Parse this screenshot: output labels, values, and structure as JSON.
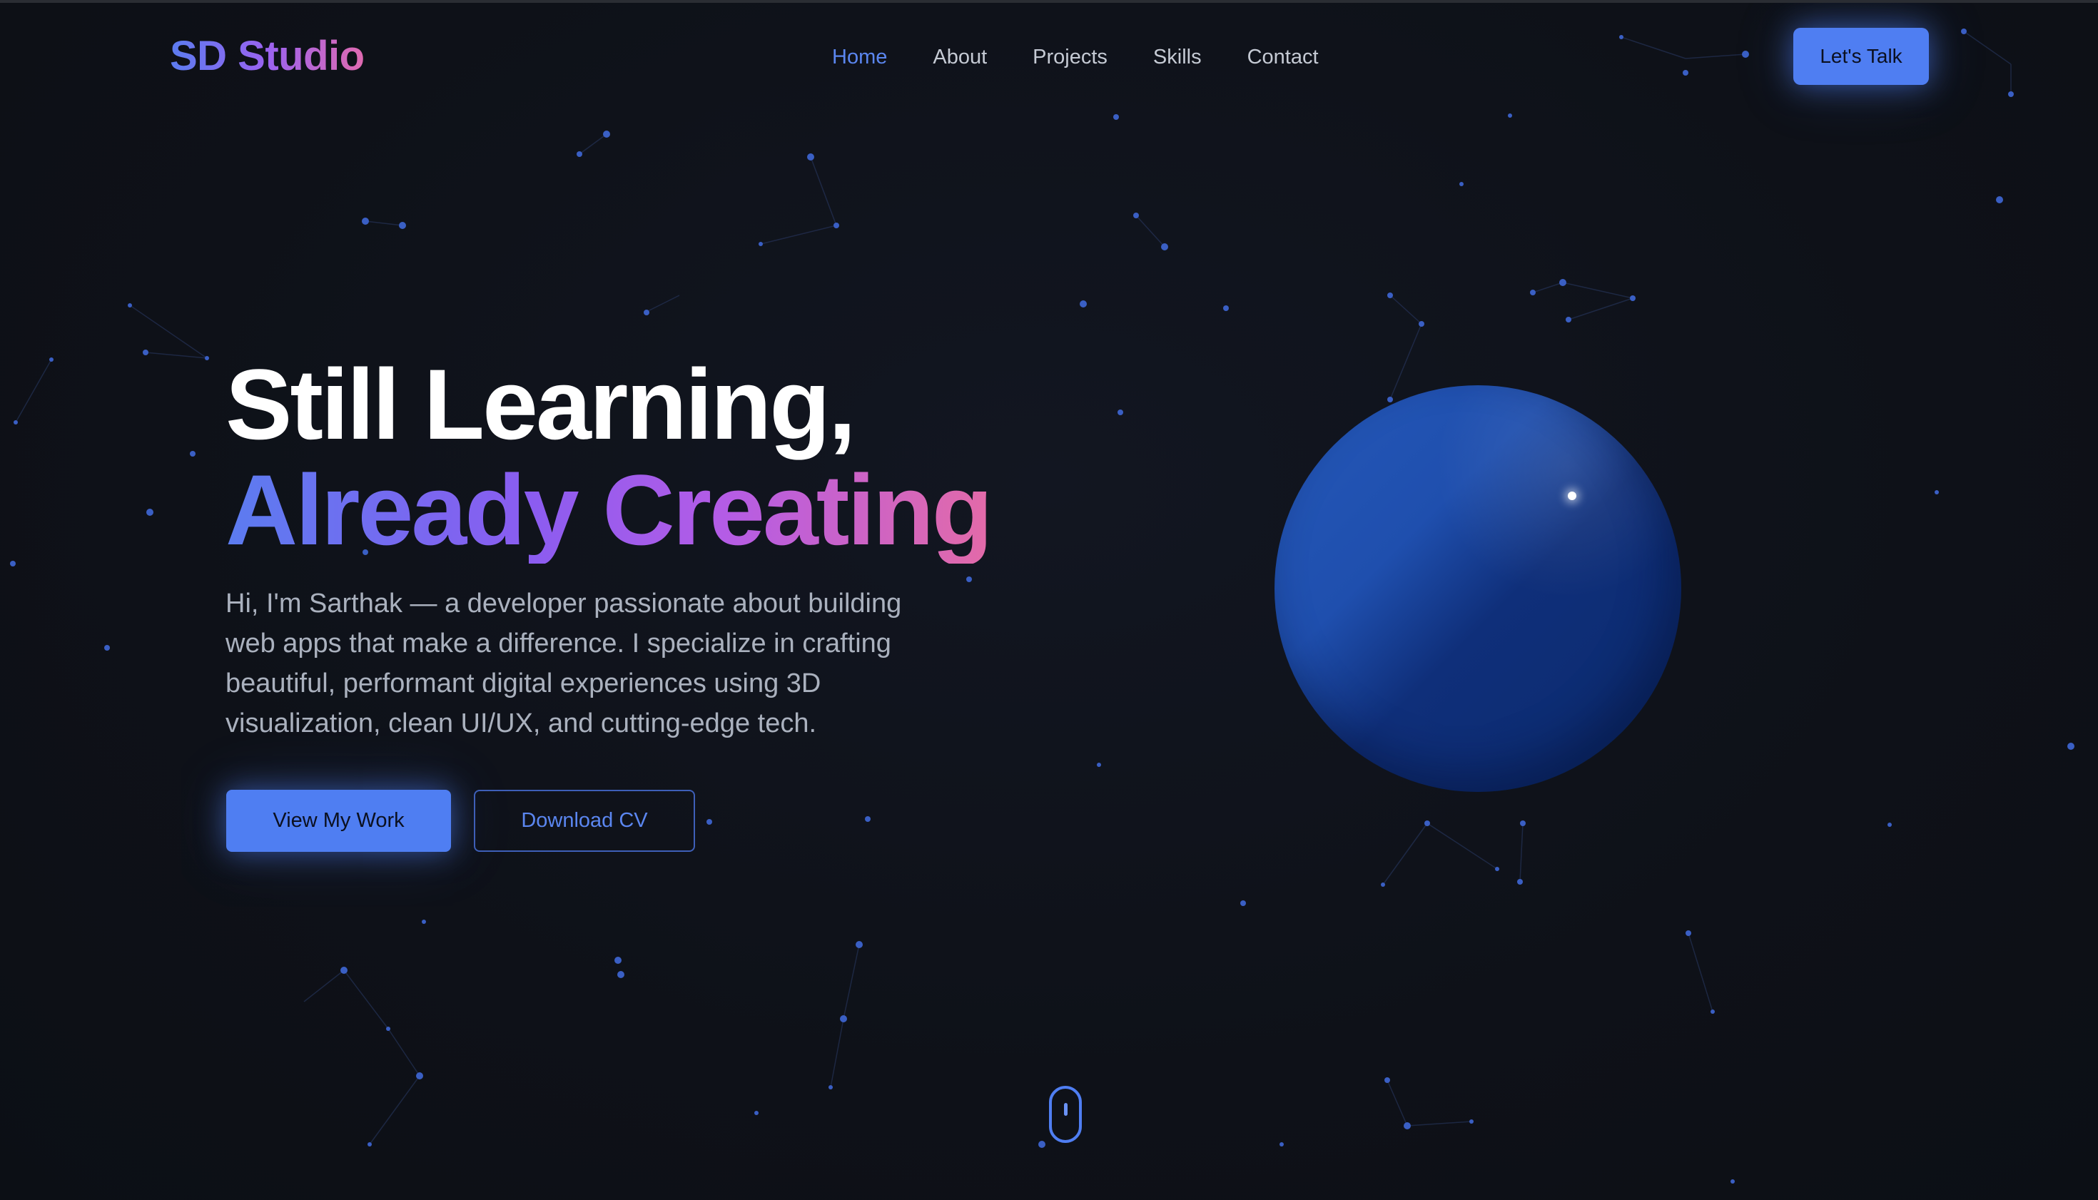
{
  "header": {
    "logo": "SD Studio",
    "nav": [
      "Home",
      "About",
      "Projects",
      "Skills",
      "Contact"
    ],
    "active_nav": "Home",
    "cta_label": "Let's Talk"
  },
  "hero": {
    "headline_line1": "Still Learning,",
    "headline_line2": "Already Creating",
    "intro": "Hi, I'm Sarthak — a developer passionate about building web apps that make a difference. I specialize in crafting beautiful, performant digital experiences using 3D visualization, clean UI/UX, and cutting-edge tech.",
    "primary_button": "View My Work",
    "secondary_button": "Download CV"
  },
  "colors": {
    "background": "#0e1118",
    "accent": "#4f7ef2",
    "gradient_start": "#5b7cf0",
    "gradient_end": "#e36aa8",
    "sphere": "#1f4fae"
  },
  "icons": {
    "scroll": "mouse-scroll-icon"
  }
}
